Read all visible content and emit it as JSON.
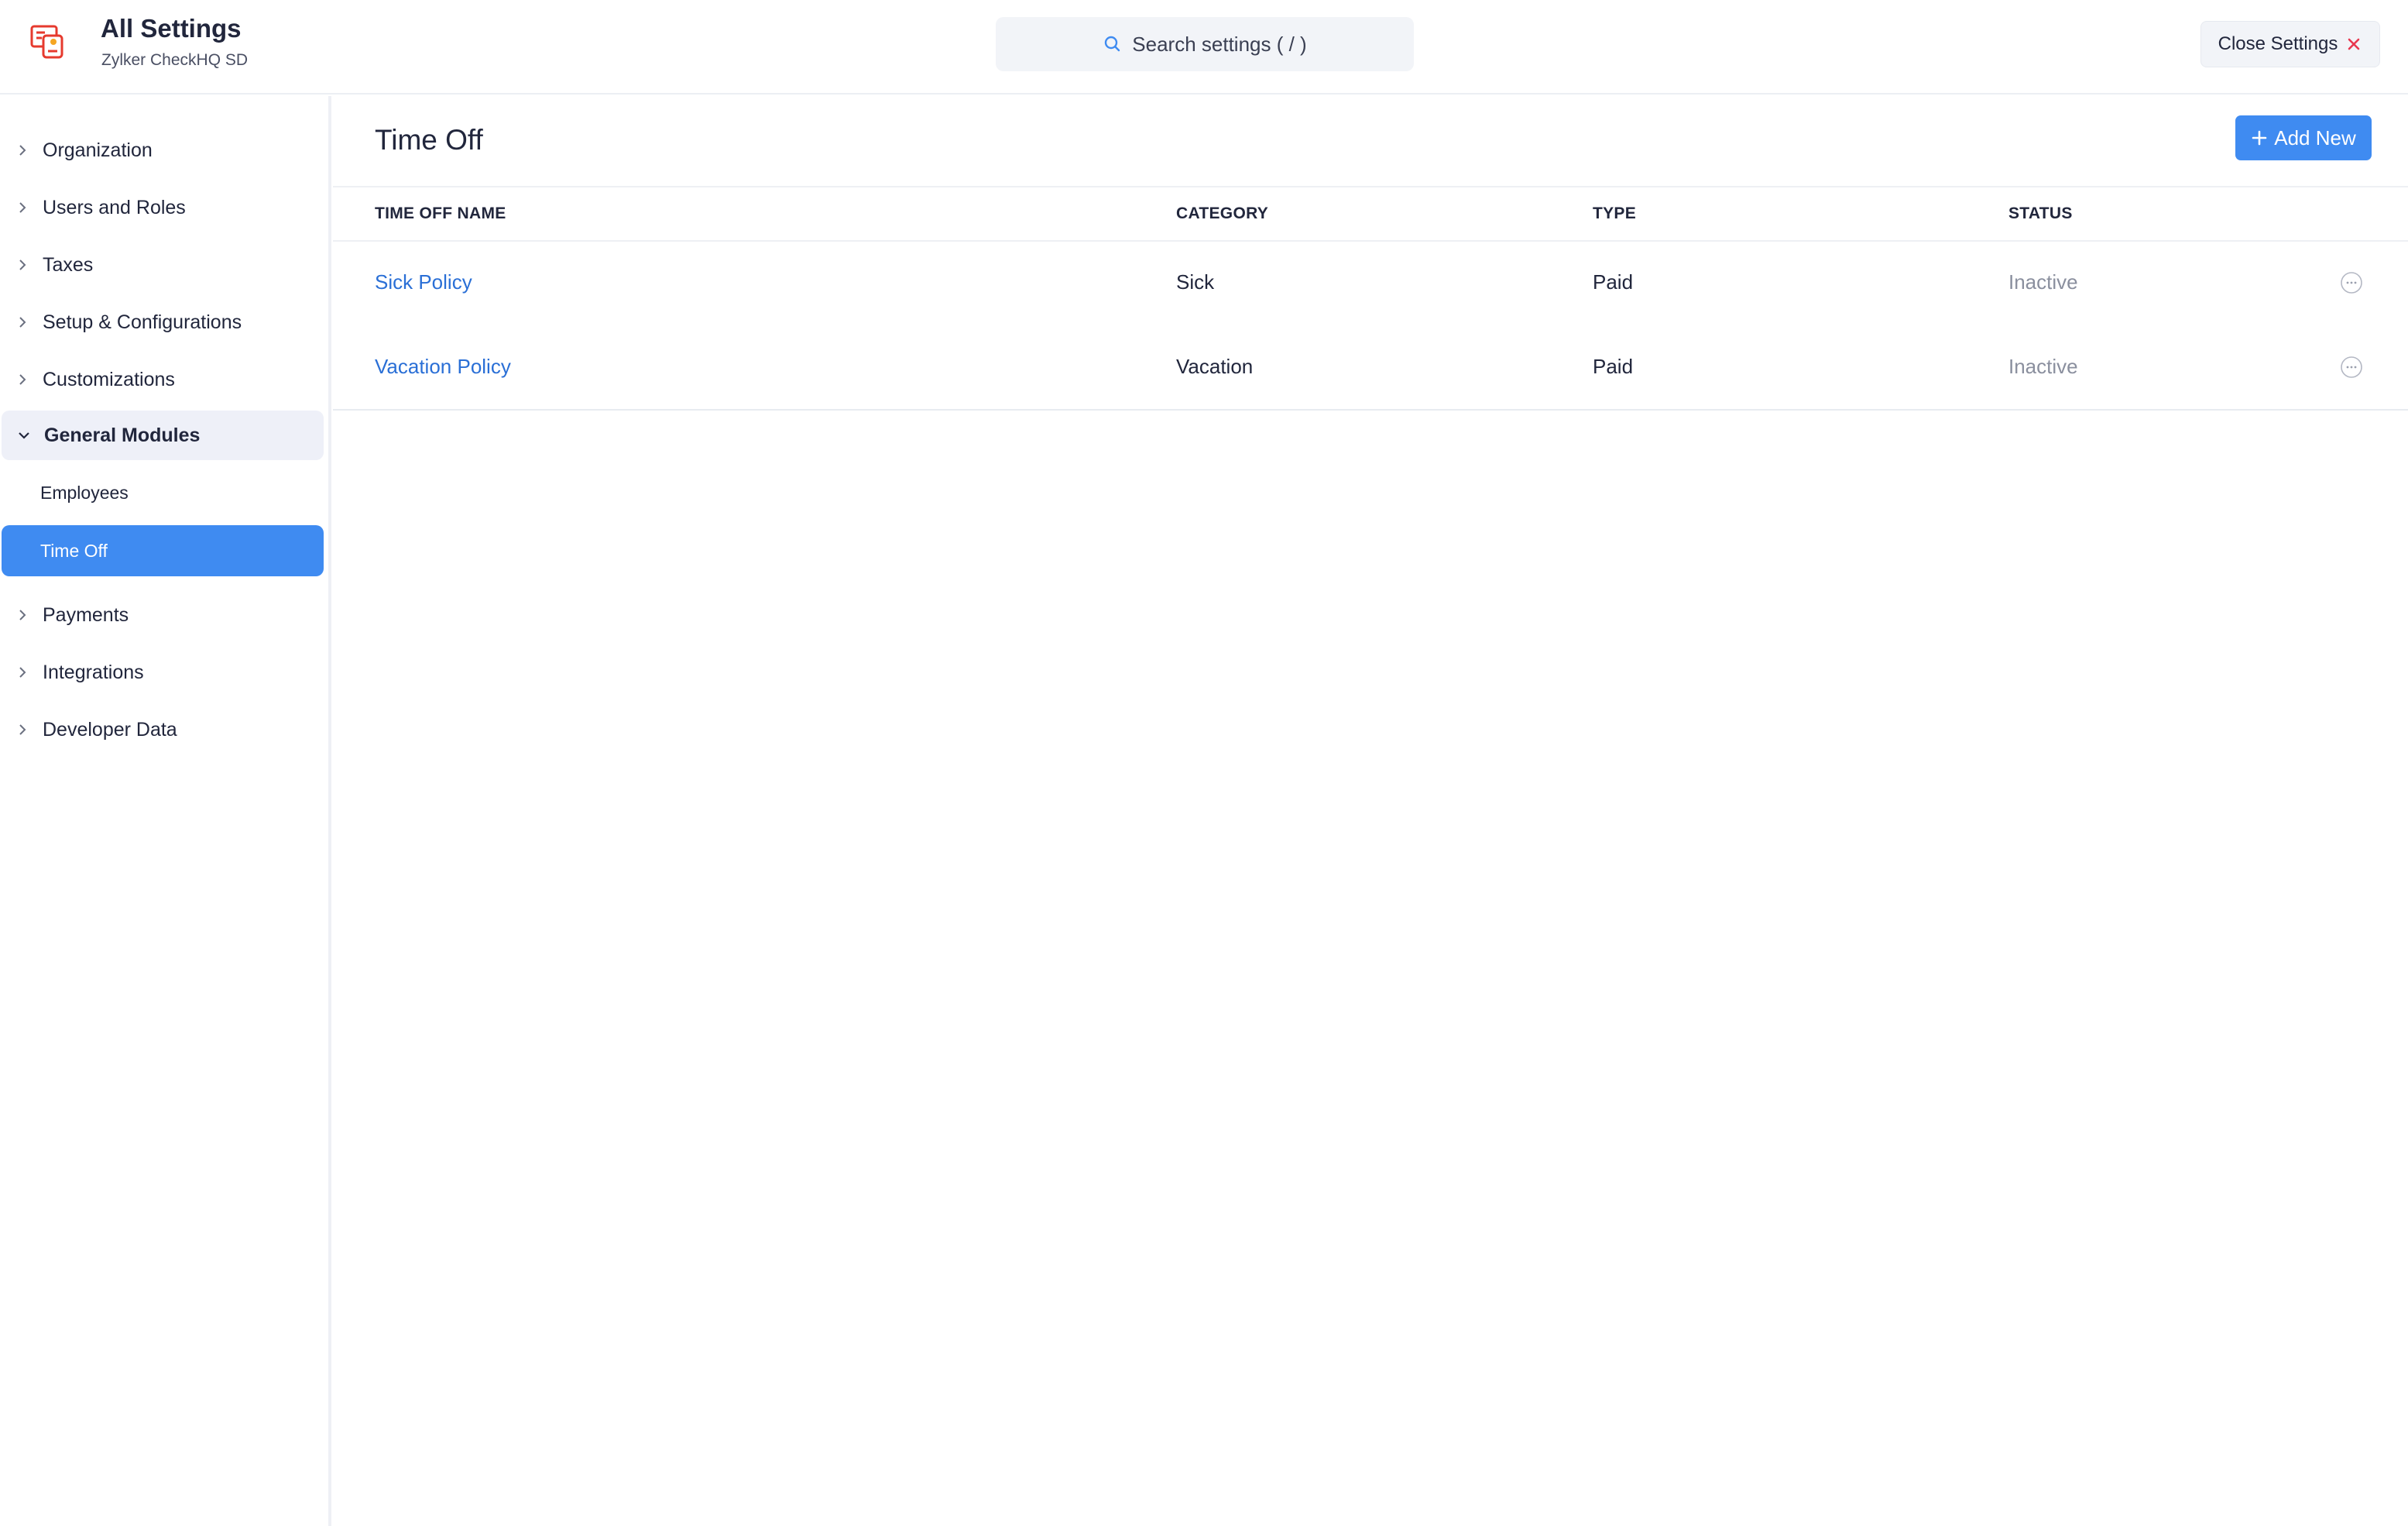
{
  "header": {
    "title": "All Settings",
    "org_name": "Zylker CheckHQ SD",
    "search_placeholder": "Search settings ( / )",
    "close_label": "Close Settings"
  },
  "sidebar": {
    "items": [
      {
        "label": "Organization"
      },
      {
        "label": "Users and Roles"
      },
      {
        "label": "Taxes"
      },
      {
        "label": "Setup & Configurations"
      },
      {
        "label": "Customizations"
      },
      {
        "label": "General Modules",
        "expanded": true
      },
      {
        "label": "Payments"
      },
      {
        "label": "Integrations"
      },
      {
        "label": "Developer Data"
      }
    ],
    "sub_items": [
      {
        "label": "Employees"
      },
      {
        "label": "Time Off",
        "active": true
      }
    ]
  },
  "main": {
    "title": "Time Off",
    "add_new_label": "Add New",
    "columns": [
      "TIME OFF NAME",
      "CATEGORY",
      "TYPE",
      "STATUS"
    ],
    "rows": [
      {
        "name": "Sick Policy",
        "category": "Sick",
        "type": "Paid",
        "status": "Inactive"
      },
      {
        "name": "Vacation Policy",
        "category": "Vacation",
        "type": "Paid",
        "status": "Inactive"
      }
    ]
  },
  "colors": {
    "accent": "#3f8bf1",
    "link": "#2a6fd6",
    "logo": "#e63a2e",
    "close_icon": "#e8384f"
  },
  "icons": {
    "logo": "settings-app-logo-icon",
    "search": "search-icon",
    "close": "close-icon",
    "chevron_right": "chevron-right-icon",
    "chevron_down": "chevron-down-icon",
    "plus": "plus-icon",
    "row_menu": "more-options-icon"
  }
}
